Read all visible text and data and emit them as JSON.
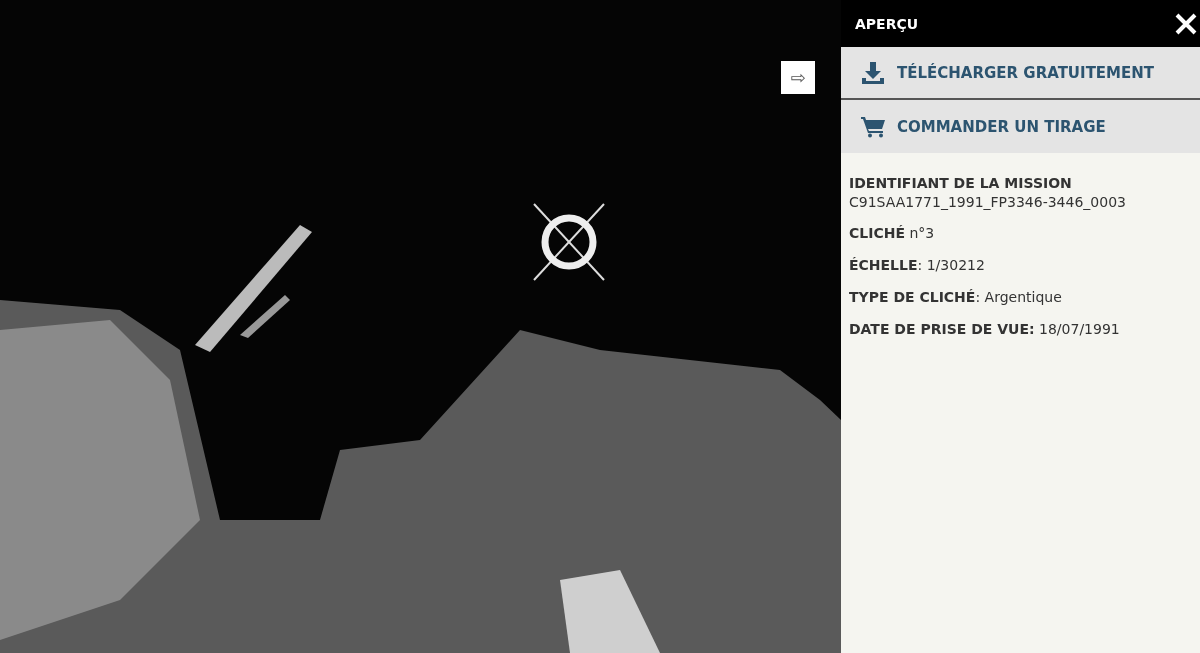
{
  "viewer": {
    "expand_button": "⇨"
  },
  "panel": {
    "title": "APERÇU",
    "actions": [
      {
        "kind": "download",
        "label": "TÉLÉCHARGER GRATUITEMENT"
      },
      {
        "kind": "cart",
        "label": "COMMANDER UN TIRAGE"
      }
    ],
    "mission": {
      "label": "IDENTIFIANT DE LA MISSION",
      "value": "C91SAA1771_1991_FP3346-3446_0003"
    },
    "details": [
      "**CLICHÉ** n°3",
      "**ÉCHELLE**: 1/30212",
      "**TYPE DE CLICHÉ**: Argentique",
      "**DATE DE PRISE DE VUE:** 18/07/1991"
    ]
  }
}
